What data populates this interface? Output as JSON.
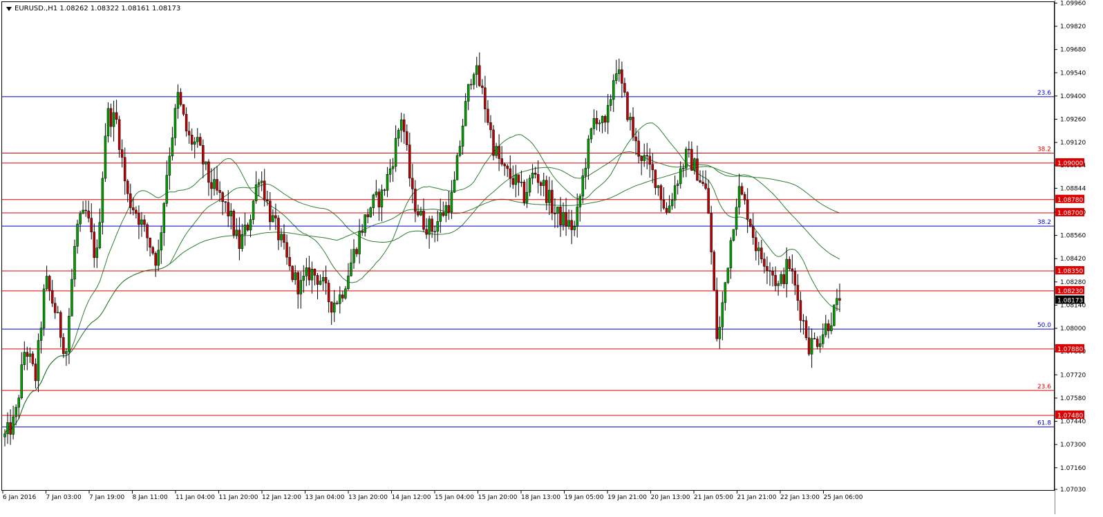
{
  "chart": {
    "title": "EURUSD.,H1  1.08262 1.08322 1.08161 1.08173",
    "current_price_label": "1.08173"
  },
  "colors": {
    "background": "#ffffff",
    "bull_candle": "#00a000",
    "bear_candle": "#c00000",
    "wick": "#000000",
    "ma": "#2e7d32",
    "fib_blue": "#0000cc",
    "level_red": "#dd0000",
    "current_price_bg": "#000000"
  },
  "price_scale": {
    "ticks": [
      "1.09960",
      "1.09820",
      "1.09680",
      "1.09540",
      "1.09400",
      "1.09260",
      "1.09120",
      "1.08984",
      "1.08844",
      "1.08700",
      "1.08560",
      "1.08420",
      "1.08280",
      "1.08140",
      "1.08000",
      "1.07860",
      "1.07720",
      "1.07580",
      "1.07440",
      "1.07300",
      "1.07160",
      "1.07030"
    ]
  },
  "time_scale": {
    "labels": [
      "6 Jan 2016",
      "7 Jan 03:00",
      "7 Jan 19:00",
      "8 Jan 11:00",
      "11 Jan 04:00",
      "11 Jan 20:00",
      "12 Jan 12:00",
      "13 Jan 04:00",
      "13 Jan 20:00",
      "14 Jan 12:00",
      "15 Jan 04:00",
      "15 Jan 20:00",
      "18 Jan 13:00",
      "19 Jan 05:00",
      "19 Jan 21:00",
      "20 Jan 13:00",
      "21 Jan 05:00",
      "21 Jan 21:00",
      "22 Jan 13:00",
      "25 Jan 06:00"
    ]
  },
  "horizontal_lines": [
    {
      "price": 1.094,
      "color": "blue",
      "label": "23.6",
      "tag": ""
    },
    {
      "price": 1.0906,
      "color": "red",
      "label": "38.2",
      "tag": ""
    },
    {
      "price": 1.09,
      "color": "red",
      "label": "",
      "tag": "1.09000"
    },
    {
      "price": 1.0878,
      "color": "red",
      "label": "",
      "tag": "1.08780"
    },
    {
      "price": 1.087,
      "color": "red",
      "label": "",
      "tag": "1.08700"
    },
    {
      "price": 1.0862,
      "color": "blue",
      "label": "38.2",
      "tag": ""
    },
    {
      "price": 1.0835,
      "color": "red",
      "label": "",
      "tag": "1.08350"
    },
    {
      "price": 1.0823,
      "color": "red",
      "label": "",
      "tag": "1.08230"
    },
    {
      "price": 1.08,
      "color": "blue",
      "label": "50.0",
      "tag": ""
    },
    {
      "price": 1.0788,
      "color": "red",
      "label": "",
      "tag": "1.07880"
    },
    {
      "price": 1.0763,
      "color": "red",
      "label": "23.6",
      "tag": ""
    },
    {
      "price": 1.0748,
      "color": "red",
      "label": "",
      "tag": "1.07480"
    },
    {
      "price": 1.0741,
      "color": "blue",
      "label": "61.8",
      "tag": ""
    }
  ],
  "price_range": [
    1.0703,
    1.0997
  ],
  "last_price": 1.08173,
  "price_path": [
    1.0735,
    1.0745,
    1.079,
    1.077,
    1.083,
    1.081,
    1.0785,
    1.086,
    1.087,
    1.084,
    1.093,
    1.0925,
    1.088,
    1.087,
    1.0855,
    1.084,
    1.09,
    1.094,
    1.0915,
    1.091,
    1.089,
    1.088,
    1.087,
    1.085,
    1.0865,
    1.0895,
    1.087,
    1.0855,
    1.0835,
    1.0825,
    1.0835,
    1.083,
    1.0815,
    1.082,
    1.084,
    1.086,
    1.0875,
    1.088,
    1.09,
    1.093,
    1.088,
    1.0865,
    1.086,
    1.087,
    1.088,
    1.0925,
    1.096,
    1.094,
    1.091,
    1.0895,
    1.089,
    1.088,
    1.0895,
    1.0885,
    1.087,
    1.0865,
    1.086,
    1.09,
    1.093,
    1.092,
    1.096,
    1.0935,
    1.091,
    1.09,
    1.089,
    1.087,
    1.089,
    1.0905,
    1.0895,
    1.088,
    1.079,
    1.084,
    1.0885,
    1.087,
    1.0845,
    1.084,
    1.0825,
    1.084,
    1.0815,
    1.079,
    1.0795,
    1.0805,
    1.0817
  ]
}
